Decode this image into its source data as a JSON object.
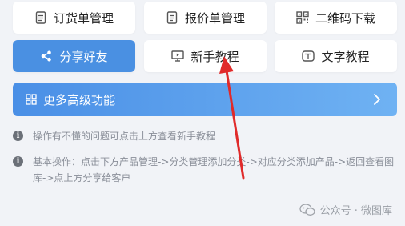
{
  "buttons": [
    {
      "label": "订货单管理",
      "icon": "document-icon"
    },
    {
      "label": "报价单管理",
      "icon": "document-icon"
    },
    {
      "label": "二维码下载",
      "icon": "qrcode-icon"
    },
    {
      "label": "分享好友",
      "icon": "share-icon",
      "active": true
    },
    {
      "label": "新手教程",
      "icon": "monitor-icon"
    },
    {
      "label": "文字教程",
      "icon": "text-doc-icon"
    }
  ],
  "banner": {
    "label": "更多高级功能",
    "icon": "grid-icon"
  },
  "notes": [
    "操作有不懂的问题可点击上方查看新手教程",
    "基本操作：点击下方产品管理->分类管理添加分类->对应分类添加产品->返回查看图库->点上方分享给客户"
  ],
  "watermark": "公众号 · 微图库",
  "colors": {
    "accent": "#4a90e2",
    "background": "#f1f3f7",
    "arrow": "#e02a2a"
  }
}
